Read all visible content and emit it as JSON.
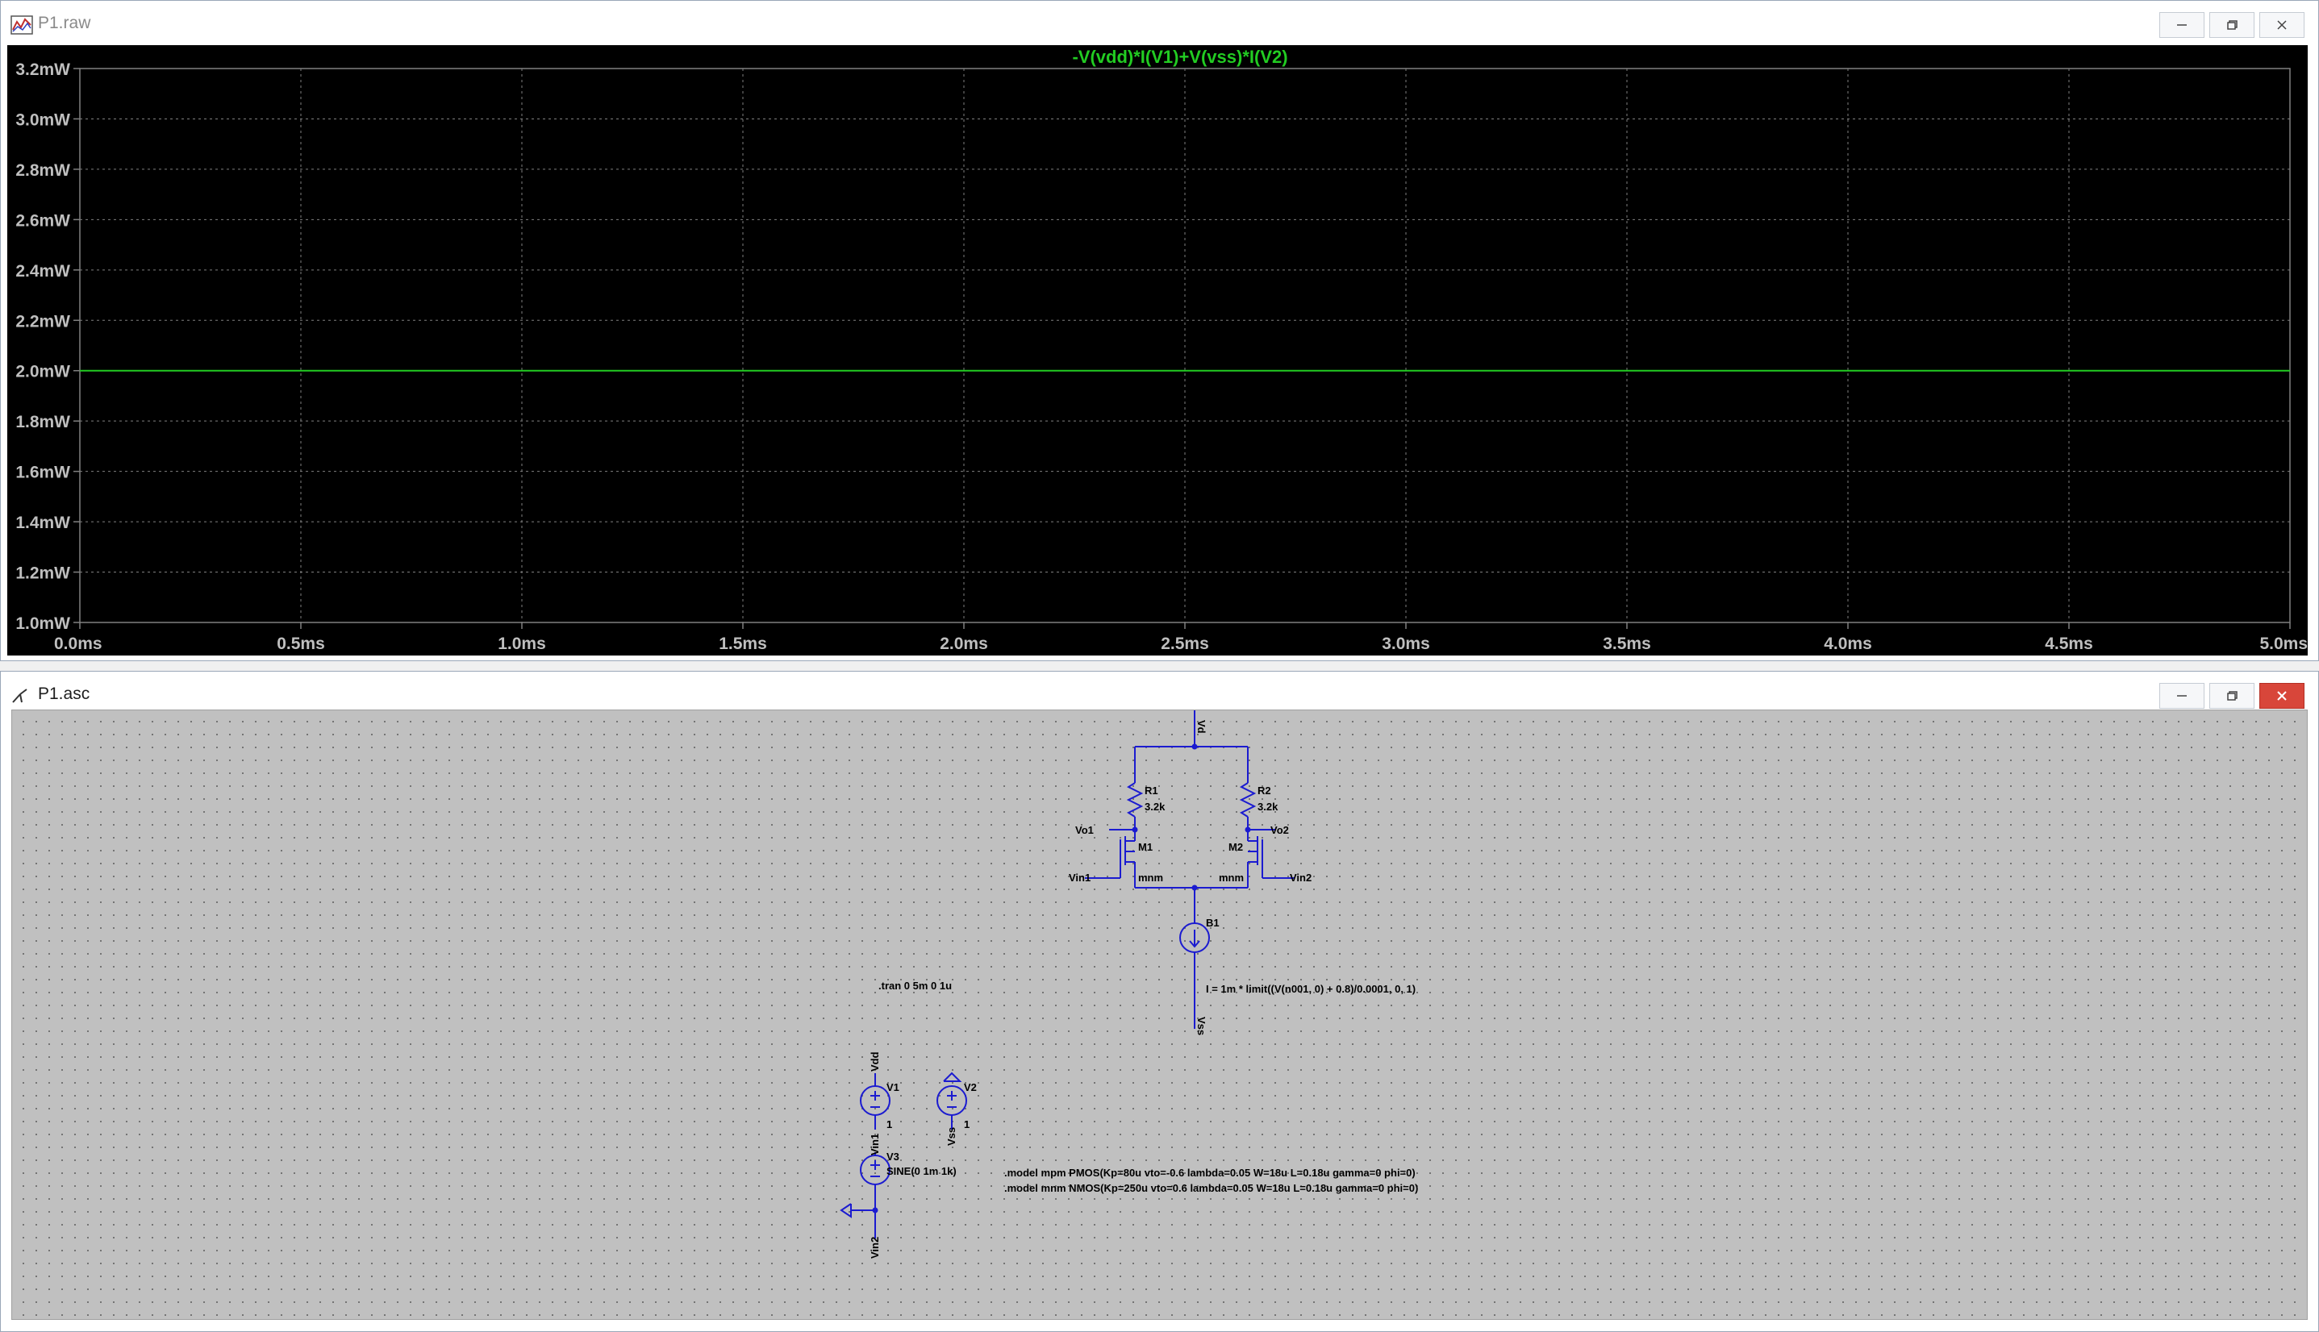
{
  "raw_window": {
    "title": "P1.raw",
    "icon": "waveform-icon",
    "controls": [
      "minimize-icon",
      "maximize-icon",
      "close-icon"
    ]
  },
  "plot": {
    "background": "#000000",
    "trace_color": "#22cc22",
    "grid_color": "#808080",
    "text_color": "#bfbfbf"
  },
  "chart_data": {
    "type": "line",
    "title": "-V(vdd)*I(V1)+V(vss)*I(V2)",
    "xlabel": "",
    "ylabel": "",
    "x_ticks": [
      "0.0ms",
      "0.5ms",
      "1.0ms",
      "1.5ms",
      "2.0ms",
      "2.5ms",
      "3.0ms",
      "3.5ms",
      "4.0ms",
      "4.5ms",
      "5.0ms"
    ],
    "y_ticks": [
      "3.2mW",
      "3.0mW",
      "2.8mW",
      "2.6mW",
      "2.4mW",
      "2.2mW",
      "2.0mW",
      "1.8mW",
      "1.6mW",
      "1.4mW",
      "1.2mW",
      "1.0mW"
    ],
    "xlim": [
      0,
      5
    ],
    "ylim": [
      1.0,
      3.2
    ],
    "grid": true,
    "series": [
      {
        "name": "-V(vdd)*I(V1)+V(vss)*I(V2)",
        "x": [
          0,
          5
        ],
        "y": [
          2.0,
          2.0
        ]
      }
    ]
  },
  "asc_window": {
    "title": "P1.asc",
    "icon": "schematic-icon",
    "controls": [
      "minimize-icon",
      "maximize-icon",
      "close-icon"
    ]
  },
  "schematic": {
    "wire_color": "#1b1bd0",
    "text_color": "#000000",
    "labels": {
      "vdd_top": "Vd",
      "r1": "R1",
      "r1_val": "3.2k",
      "r2": "R2",
      "r2_val": "3.2k",
      "vo1": "Vo1",
      "vo2": "Vo2",
      "m1": "M1",
      "m1_model": "mnm",
      "m2": "M2",
      "m2_model": "mnm",
      "vin1": "Vin1",
      "vin2": "Vin2",
      "b1": "B1",
      "b1_expr": "I = 1m * limit((V(n001, 0) + 0.8)/0.0001, 0, 1)",
      "vss_b1": "Vss",
      "tran": ".tran 0 5m 0 1u",
      "vdd_v1": "Vdd",
      "v1": "V1",
      "v1_val": "1",
      "v2": "V2",
      "v2_val": "1",
      "vss_v2": "Vss",
      "vin1_v3": "Vin1",
      "v3": "V3",
      "v3_val": "SINE(0 1m 1k)",
      "vin2_bottom": "Vin2",
      "model_pmos": ".model mpm PMOS(Kp=80u vto=-0.6 lambda=0.05 W=18u L=0.18u gamma=0 phi=0)",
      "model_nmos": ".model mnm NMOS(Kp=250u vto=0.6 lambda=0.05 W=18u L=0.18u gamma=0 phi=0)"
    }
  }
}
